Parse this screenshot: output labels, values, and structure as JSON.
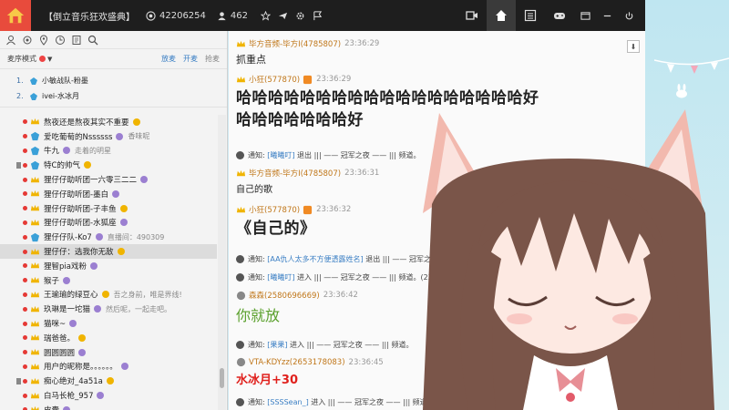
{
  "window": {
    "title": "【倒立音乐狂欢盛典】",
    "room_id": "42206254",
    "user_count": "462"
  },
  "colors": {
    "topbar": "#1e1e1e",
    "logo": "#e84b3c",
    "name_orange": "#c0771a",
    "link_blue": "#3b7fc4",
    "green_text": "#5aa02c",
    "red_text": "#e0201c"
  },
  "nav_icons": [
    "video-icon",
    "home-icon",
    "list-icon",
    "gamepad-icon",
    "window-icon",
    "minimize-icon",
    "power-icon"
  ],
  "left": {
    "mode_label": "麦序模式",
    "buttons": {
      "release": "放麦",
      "open": "开麦",
      "grab": "抢麦"
    },
    "queue": [
      {
        "n": "1.",
        "name": "小敏战队-粉墨"
      },
      {
        "n": "2.",
        "name": "ivei-水冰月"
      }
    ],
    "users": [
      {
        "name": "熬夜还是熬夜其实不重要",
        "note": ""
      },
      {
        "name": "爱吃葡萄的Nssssss",
        "note": "香味呢"
      },
      {
        "name": "牛九",
        "note": "走着的明星"
      },
      {
        "name": "特C的帅气",
        "note": ""
      },
      {
        "name": "狸仔仔助听团一六零三二二",
        "note": ""
      },
      {
        "name": "狸仔仔助听团-墨白",
        "note": ""
      },
      {
        "name": "狸仔仔助听团-子丰鱼",
        "note": ""
      },
      {
        "name": "狸仔仔助听团-水狐座",
        "note": ""
      },
      {
        "name": "狸仔仔队-Ko7",
        "note": "直播间：490309"
      },
      {
        "name": "狸仔仔：选我你无敌",
        "note": ""
      },
      {
        "name": "狸智pia戏粉",
        "note": ""
      },
      {
        "name": "猴子",
        "note": ""
      },
      {
        "name": "王瑜瑜的绿豆心",
        "note": "吾之身前，唯是界线!"
      },
      {
        "name": "玖琳是一坨猫",
        "note": "然后呢，一起走吧。"
      },
      {
        "name": "猫咪~",
        "note": ""
      },
      {
        "name": "瑞爸爸。",
        "note": ""
      },
      {
        "name": "圆圆圆圆",
        "note": ""
      },
      {
        "name": "用户的昵称是。。。。。。",
        "note": ""
      },
      {
        "name": "痴心绝对_4a51a",
        "note": ""
      },
      {
        "name": "白马长枪_957",
        "note": ""
      },
      {
        "name": "皮囊",
        "note": ""
      }
    ]
  },
  "chat": {
    "messages": [
      {
        "name": "毕方音频-毕方I(4785807)",
        "time": "23:36:29",
        "text": "抓重点"
      },
      {
        "name": "小狂(577870)",
        "time": "23:36:29",
        "text_line1": "哈哈哈哈哈哈哈哈哈哈哈哈哈哈哈哈哈哈好",
        "text_line2": "哈哈哈哈哈哈哈好"
      },
      {
        "name": "毕方音频-毕方I(4785807)",
        "time": "23:36:31",
        "text": "自己的歌"
      },
      {
        "name": "小狂(577870)",
        "time": "23:36:32",
        "text": "《自己的》"
      },
      {
        "name": "森森(2580696669)",
        "time": "23:36:42",
        "text": "你就放"
      },
      {
        "name": "VTA-KDYzz(2653178083)",
        "time": "23:36:45",
        "text": "水冰月+30"
      }
    ],
    "notices": [
      {
        "label": "通知:",
        "who": "[曦曦叮]",
        "action": "退出 |||  ——  冠军之夜  ——  |||  频道。"
      },
      {
        "label": "通知:",
        "who": "[曦曦叮]",
        "action": "进入 |||  ——  冠军之夜  ——  |||  频道。(23:36:31)"
      },
      {
        "label": "通知:",
        "who": "[AA仇人太多不方便透露姓名]",
        "action": "退出 |||  ——  冠军之夜  ——  |||  频道。"
      },
      {
        "label": "通知:",
        "who": "[曦曦叮]",
        "action": "进入 |||  ——  冠军之夜  ——  |||  频道。(23:36:"
      },
      {
        "label": "通知:",
        "who": "[果果]",
        "action": "进入 |||  ——  冠军之夜  ——  |||  频道。"
      },
      {
        "label": "通知:",
        "who": "[SSSSean_]",
        "action": "进入 |||  ——  冠军之夜  ——  |||  频道。"
      }
    ]
  }
}
